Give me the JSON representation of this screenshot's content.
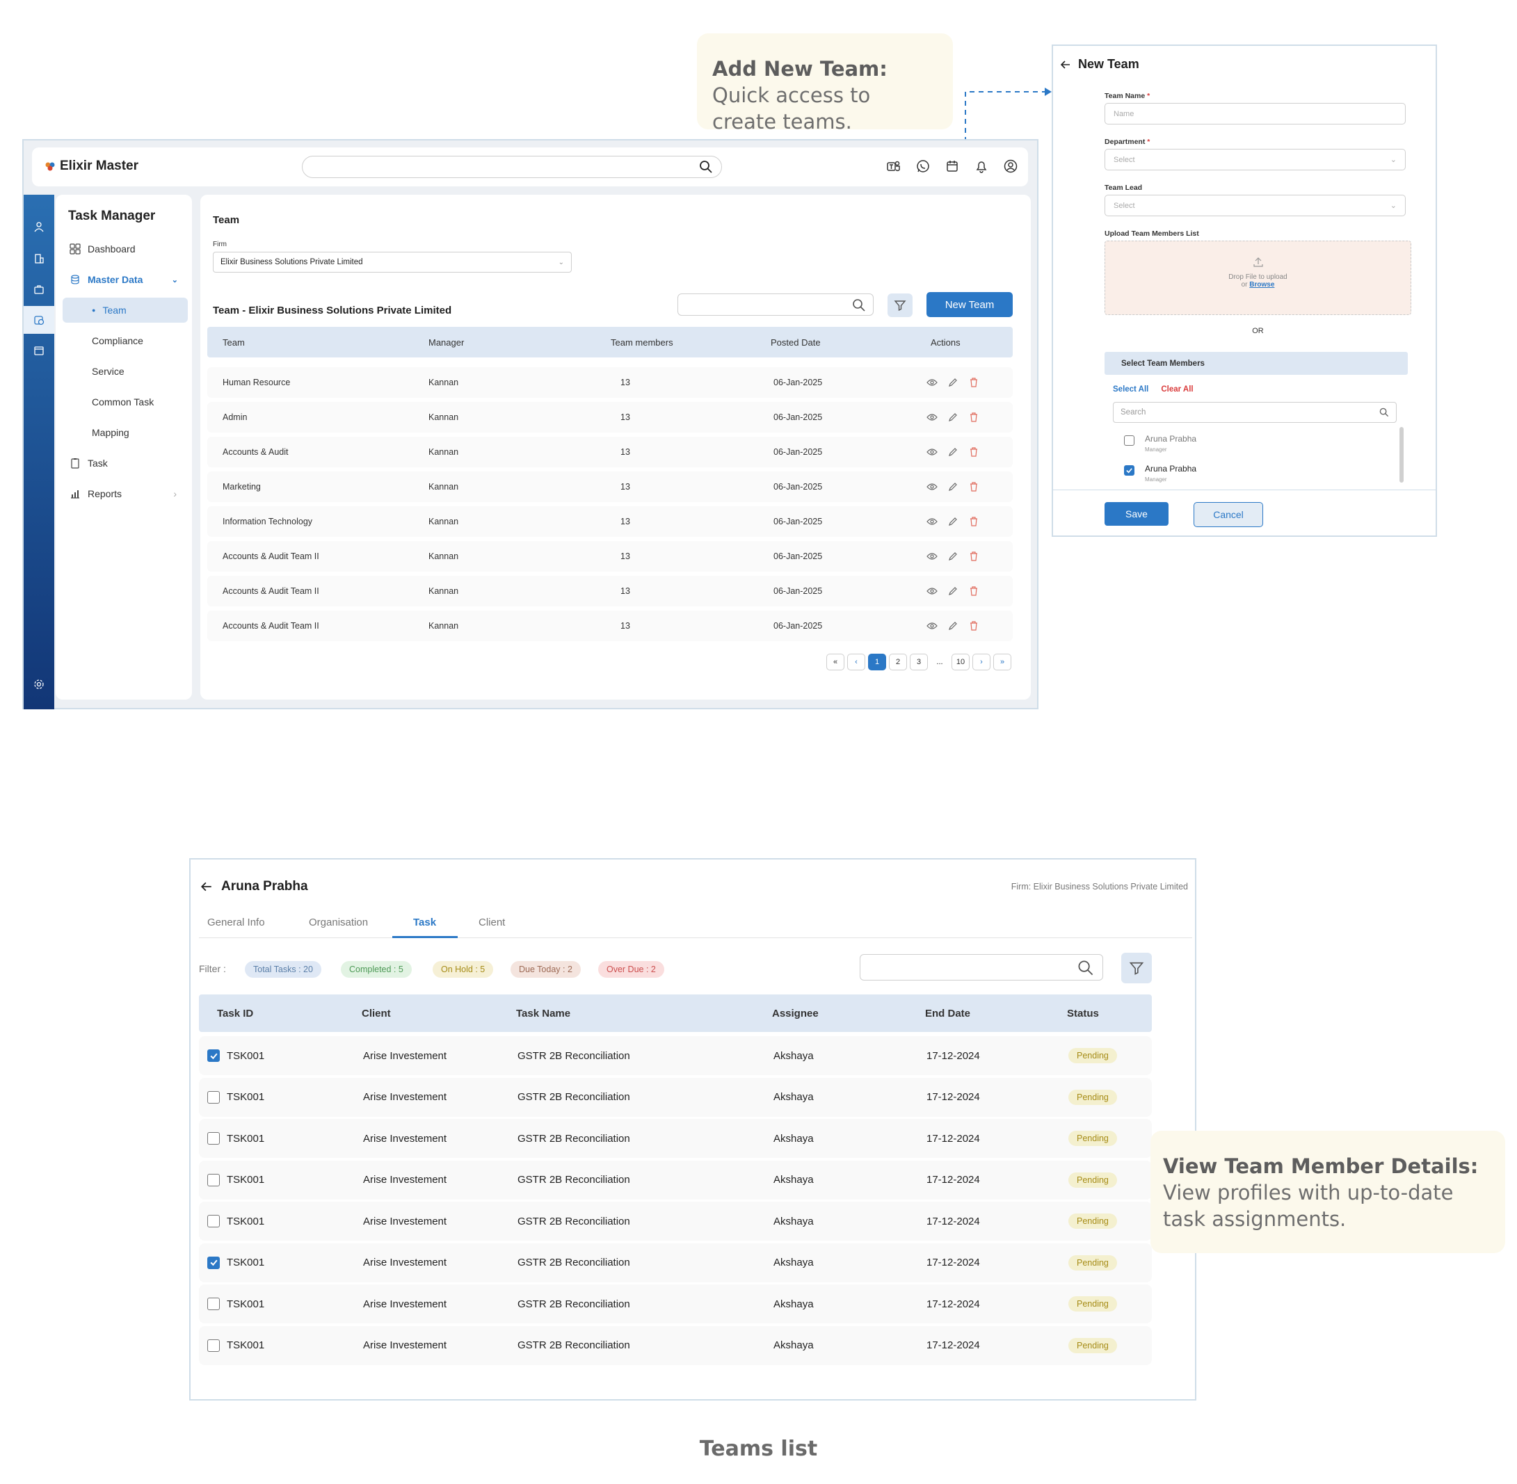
{
  "callouts": {
    "add_team_bold": "Add New Team:",
    "add_team_text": " Quick access to create teams.",
    "view_member_bold": "View Team Member Details:",
    "view_member_text": "  View profiles with up-to-date task assignments."
  },
  "caption": "Teams list",
  "colors": {
    "primary": "#2b78c6",
    "rail_top": "#2a6fb2",
    "rail_bottom": "#123676",
    "table_head": "#dde7f3",
    "delete": "#e06a5c"
  },
  "app": {
    "brand": "Elixir Master",
    "module_title": "Task Manager",
    "nav": {
      "dashboard": "Dashboard",
      "master_data": "Master Data",
      "team": "Team",
      "compliance": "Compliance",
      "service": "Service",
      "common_task": "Common Task",
      "mapping": "Mapping",
      "task": "Task",
      "reports": "Reports"
    },
    "page_title": "Team",
    "firm_label": "Firm",
    "firm_value": "Elixir Business Solutions Private Limited",
    "list_title": "Team - Elixir Business Solutions Private Limited",
    "new_team_button": "New Team",
    "columns": [
      "Team",
      "Manager",
      "Team members",
      "Posted Date",
      "Actions"
    ],
    "rows": [
      [
        "Human Resource",
        "Kannan",
        "13",
        "06-Jan-2025"
      ],
      [
        "Admin",
        "Kannan",
        "13",
        "06-Jan-2025"
      ],
      [
        "Accounts & Audit",
        "Kannan",
        "13",
        "06-Jan-2025"
      ],
      [
        "Marketing",
        "Kannan",
        "13",
        "06-Jan-2025"
      ],
      [
        "Information Technology",
        "Kannan",
        "13",
        "06-Jan-2025"
      ],
      [
        "Accounts & Audit Team II",
        "Kannan",
        "13",
        "06-Jan-2025"
      ],
      [
        "Accounts & Audit Team II",
        "Kannan",
        "13",
        "06-Jan-2025"
      ],
      [
        "Accounts & Audit Team II",
        "Kannan",
        "13",
        "06-Jan-2025"
      ]
    ],
    "pagination": {
      "first": "«",
      "prev": "‹",
      "pages": [
        "1",
        "2",
        "3"
      ],
      "current": "1",
      "ellipsis": "...",
      "last_page": "10",
      "next": "›",
      "last": "»"
    }
  },
  "new_team": {
    "title": "New Team",
    "team_name_label": "Team Name",
    "team_name_placeholder": "Name",
    "department_label": "Department",
    "department_placeholder": "Select",
    "team_lead_label": "Team Lead",
    "team_lead_placeholder": "Select",
    "required_mark": "*",
    "upload_label": "Upload Team Members List",
    "drop_text": "Drop File to upload",
    "or_text": "or",
    "browse_text": "Browse",
    "or_divider": "OR",
    "select_members_title": "Select Team Members",
    "select_all": "Select All",
    "clear_all": "Clear All",
    "search_placeholder": "Search",
    "members": [
      {
        "name": "Aruna Prabha",
        "role": "Manager",
        "checked": false
      },
      {
        "name": "Aruna Prabha",
        "role": "Manager",
        "checked": true
      }
    ],
    "save_button": "Save",
    "cancel_button": "Cancel"
  },
  "member_detail": {
    "name": "Aruna Prabha",
    "firm": "Firm: Elixir Business Solutions Private Limited",
    "tabs": [
      "General Info",
      "Organisation",
      "Task",
      "Client"
    ],
    "active_tab": "Task",
    "filter_label": "Filter :",
    "chips": {
      "total": "Total Tasks : 20",
      "completed": "Completed : 5",
      "on_hold": "On Hold : 5",
      "due_today": "Due Today : 2",
      "over_due": "Over Due : 2"
    },
    "columns": [
      "Task ID",
      "Client",
      "Task Name",
      "Assignee",
      "End Date",
      "Status"
    ],
    "rows": [
      {
        "checked": true,
        "id": "TSK001",
        "client": "Arise Investement",
        "task": "GSTR 2B Reconciliation",
        "assignee": "Akshaya",
        "end": "17-12-2024",
        "status": "Pending"
      },
      {
        "checked": false,
        "id": "TSK001",
        "client": "Arise Investement",
        "task": "GSTR 2B Reconciliation",
        "assignee": "Akshaya",
        "end": "17-12-2024",
        "status": "Pending"
      },
      {
        "checked": false,
        "id": "TSK001",
        "client": "Arise Investement",
        "task": "GSTR 2B Reconciliation",
        "assignee": "Akshaya",
        "end": "17-12-2024",
        "status": "Pending"
      },
      {
        "checked": false,
        "id": "TSK001",
        "client": "Arise Investement",
        "task": "GSTR 2B Reconciliation",
        "assignee": "Akshaya",
        "end": "17-12-2024",
        "status": "Pending"
      },
      {
        "checked": false,
        "id": "TSK001",
        "client": "Arise Investement",
        "task": "GSTR 2B Reconciliation",
        "assignee": "Akshaya",
        "end": "17-12-2024",
        "status": "Pending"
      },
      {
        "checked": true,
        "id": "TSK001",
        "client": "Arise Investement",
        "task": "GSTR 2B Reconciliation",
        "assignee": "Akshaya",
        "end": "17-12-2024",
        "status": "Pending"
      },
      {
        "checked": false,
        "id": "TSK001",
        "client": "Arise Investement",
        "task": "GSTR 2B Reconciliation",
        "assignee": "Akshaya",
        "end": "17-12-2024",
        "status": "Pending"
      },
      {
        "checked": false,
        "id": "TSK001",
        "client": "Arise Investement",
        "task": "GSTR 2B Reconciliation",
        "assignee": "Akshaya",
        "end": "17-12-2024",
        "status": "Pending"
      }
    ]
  }
}
